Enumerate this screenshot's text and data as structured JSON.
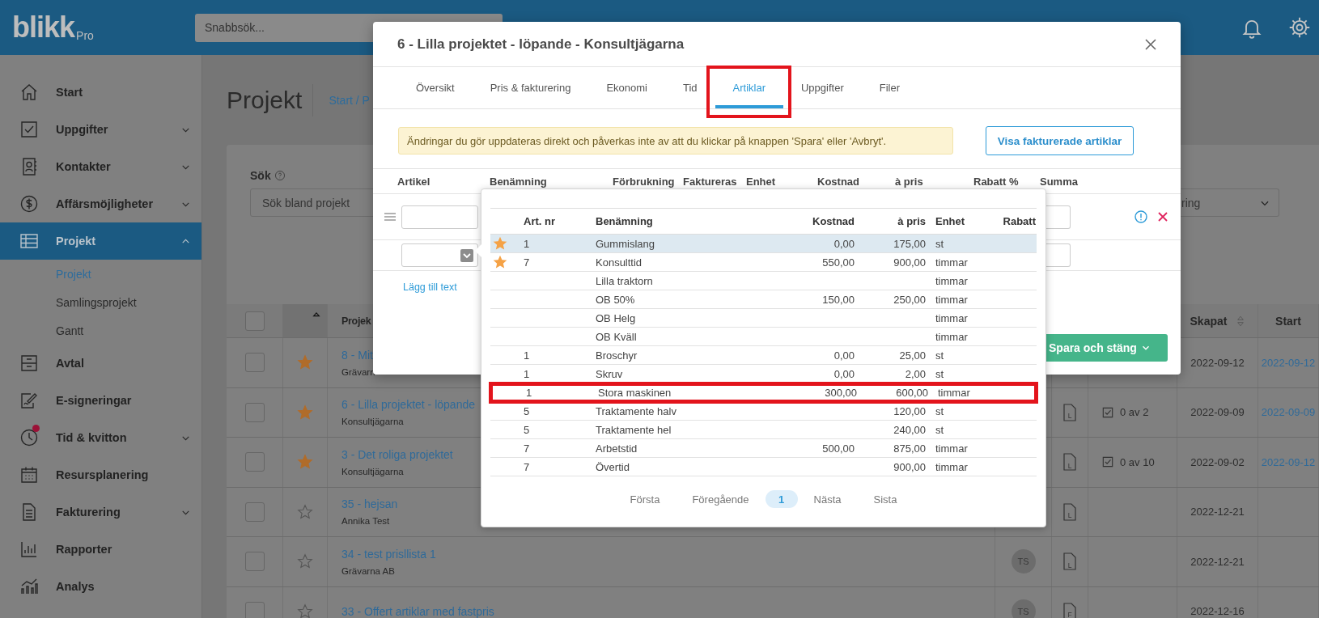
{
  "header": {
    "logo": "blikk",
    "logo_suffix": "Pro",
    "search": {
      "placeholder": "Snabbsök..."
    }
  },
  "sidebar": {
    "items": [
      {
        "label": "Start",
        "selected": false,
        "expandable": false,
        "badge": false
      },
      {
        "label": "Uppgifter",
        "selected": false,
        "expandable": true,
        "expanded": false,
        "badge": false
      },
      {
        "label": "Kontakter",
        "selected": false,
        "expandable": true,
        "expanded": false,
        "badge": false
      },
      {
        "label": "Affärsmöjligheter",
        "selected": false,
        "expandable": true,
        "expanded": false,
        "badge": false
      },
      {
        "label": "Projekt",
        "selected": true,
        "expandable": true,
        "expanded": true,
        "badge": false,
        "children": [
          {
            "label": "Projekt",
            "selected": true
          },
          {
            "label": "Samlingsprojekt",
            "selected": false
          },
          {
            "label": "Gantt",
            "selected": false
          }
        ]
      },
      {
        "label": "Avtal",
        "selected": false,
        "expandable": false,
        "badge": false
      },
      {
        "label": "E-signeringar",
        "selected": false,
        "expandable": false,
        "badge": false
      },
      {
        "label": "Tid & kvitton",
        "selected": false,
        "expandable": true,
        "expanded": false,
        "badge": true
      },
      {
        "label": "Resursplanering",
        "selected": false,
        "expandable": false,
        "badge": false
      },
      {
        "label": "Fakturering",
        "selected": false,
        "expandable": true,
        "expanded": false,
        "badge": false
      },
      {
        "label": "Rapporter",
        "selected": false,
        "expandable": false,
        "badge": false
      },
      {
        "label": "Analys",
        "selected": false,
        "expandable": false,
        "badge": false
      }
    ]
  },
  "page": {
    "title": "Projekt",
    "breadcrumb": "Start / P",
    "search_label": "Sök",
    "search": {
      "placeholder": "Sök bland projekt"
    },
    "filter": {
      "value": "ring"
    }
  },
  "table": {
    "select_all": {
      "checked": false
    },
    "columns": {
      "project": "Projek",
      "created": "Skapat",
      "start": "Start"
    },
    "rows": [
      {
        "checked": false,
        "title": "8 - Mit",
        "customer": "Grävarn",
        "starred": true,
        "created": "2022-09-12",
        "start": "2022-09-12"
      },
      {
        "checked": false,
        "title": "6 - Lilla projektet - löpande",
        "customer": "Konsultjägarna",
        "starred": true,
        "document": "L",
        "tasks": "0 av 2",
        "created": "2022-09-09",
        "start": "2022-09-09"
      },
      {
        "checked": false,
        "title": "3 - Det roliga projektet",
        "customer": "Konsultjägarna",
        "starred": true,
        "document": "L",
        "tasks": "0 av 10",
        "created": "2022-09-02",
        "start": "2022-09-12"
      },
      {
        "checked": false,
        "title": "35 - hejsan",
        "customer": "Annika Test",
        "starred": false,
        "document": "L",
        "created": "2022-12-21"
      },
      {
        "checked": false,
        "title": "34 - test prisllista 1",
        "customer": "Grävarna AB",
        "starred": false,
        "avatar": "TS",
        "document": "L",
        "created": "2022-12-21"
      },
      {
        "checked": false,
        "title": "33 - Offert artiklar med fastpris",
        "starred": false,
        "avatar": "TS",
        "document": "F",
        "created": "2022-12-16"
      }
    ]
  },
  "modal": {
    "title": "6 - Lilla projektet - löpande - Konsultjägarna",
    "tabs": [
      {
        "label": "Översikt",
        "selected": false,
        "highlighted": false
      },
      {
        "label": "Pris & fakturering",
        "selected": false,
        "highlighted": false
      },
      {
        "label": "Ekonomi",
        "selected": false,
        "highlighted": false
      },
      {
        "label": "Tid",
        "selected": false,
        "highlighted": false
      },
      {
        "label": "Artiklar",
        "selected": true,
        "highlighted": true
      },
      {
        "label": "Uppgifter",
        "selected": false,
        "highlighted": false
      },
      {
        "label": "Filer",
        "selected": false,
        "highlighted": false
      }
    ],
    "notice": "Ändringar du gör uppdateras direkt och påverkas inte av att du klickar på knappen 'Spara' eller 'Avbryt'.",
    "invoiced_button": "Visa fakturerade artiklar",
    "columns": [
      "Artikel",
      "Benämning",
      "Förbrukning",
      "Faktureras",
      "Enhet",
      "Kostnad",
      "à pris",
      "Rabatt %",
      "Summa"
    ],
    "add_text_link": "Lägg till text",
    "save_button": "Spara och stäng"
  },
  "picker": {
    "columns": [
      "Art. nr",
      "Benämning",
      "Kostnad",
      "à pris",
      "Enhet",
      "Rabatt"
    ],
    "rows": [
      {
        "starred": true,
        "selected": true,
        "highlighted": false,
        "art_nr": "1",
        "name": "Gummislang",
        "cost": "0,00",
        "price": "175,00",
        "unit": "st"
      },
      {
        "starred": true,
        "selected": false,
        "highlighted": false,
        "art_nr": "7",
        "name": "Konsulttid",
        "cost": "550,00",
        "price": "900,00",
        "unit": "timmar"
      },
      {
        "starred": false,
        "selected": false,
        "highlighted": false,
        "name": "Lilla traktorn",
        "unit": "timmar"
      },
      {
        "starred": false,
        "selected": false,
        "highlighted": false,
        "name": "OB 50%",
        "cost": "150,00",
        "price": "250,00",
        "unit": "timmar"
      },
      {
        "starred": false,
        "selected": false,
        "highlighted": false,
        "name": "OB Helg",
        "unit": "timmar"
      },
      {
        "starred": false,
        "selected": false,
        "highlighted": false,
        "name": "OB Kväll",
        "unit": "timmar"
      },
      {
        "starred": false,
        "selected": false,
        "highlighted": false,
        "art_nr": "1",
        "name": "Broschyr",
        "cost": "0,00",
        "price": "25,00",
        "unit": "st"
      },
      {
        "starred": false,
        "selected": false,
        "highlighted": false,
        "art_nr": "1",
        "name": "Skruv",
        "cost": "0,00",
        "price": "2,00",
        "unit": "st"
      },
      {
        "starred": false,
        "selected": false,
        "highlighted": true,
        "art_nr": "1",
        "name": "Stora maskinen",
        "cost": "300,00",
        "price": "600,00",
        "unit": "timmar"
      },
      {
        "starred": false,
        "selected": false,
        "highlighted": false,
        "art_nr": "5",
        "name": "Traktamente halv",
        "price": "120,00",
        "unit": "st"
      },
      {
        "starred": false,
        "selected": false,
        "highlighted": false,
        "art_nr": "5",
        "name": "Traktamente hel",
        "price": "240,00",
        "unit": "st"
      },
      {
        "starred": false,
        "selected": false,
        "highlighted": false,
        "art_nr": "7",
        "name": "Arbetstid",
        "cost": "500,00",
        "price": "875,00",
        "unit": "timmar"
      },
      {
        "starred": false,
        "selected": false,
        "highlighted": false,
        "art_nr": "7",
        "name": "Övertid",
        "price": "900,00",
        "unit": "timmar"
      }
    ],
    "pagination": [
      {
        "label": "Första",
        "selected": false
      },
      {
        "label": "Föregående",
        "selected": false
      },
      {
        "label": "1",
        "selected": true
      },
      {
        "label": "Nästa",
        "selected": false
      },
      {
        "label": "Sista",
        "selected": false
      }
    ]
  }
}
